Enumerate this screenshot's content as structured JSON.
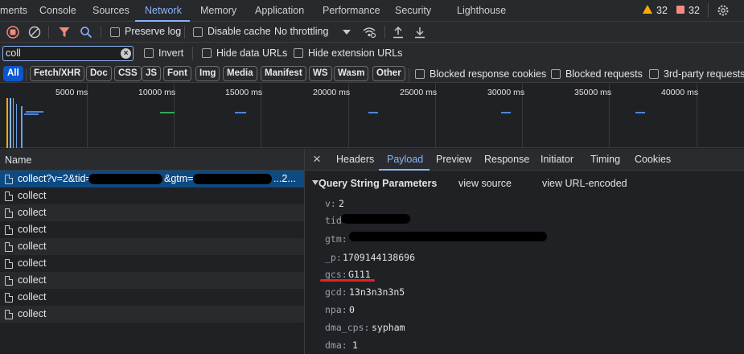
{
  "tabs": [
    "ments",
    "Console",
    "Sources",
    "Network",
    "Memory",
    "Application",
    "Performance",
    "Security",
    "Lighthouse"
  ],
  "warnings": {
    "count": "32",
    "issues": "32"
  },
  "toolbar": {
    "preserve_log": "Preserve log",
    "disable_cache": "Disable cache",
    "throttling": "No throttling"
  },
  "filter": {
    "value": "coll",
    "invert": "Invert",
    "hide_data": "Hide data URLs",
    "hide_ext": "Hide extension URLs"
  },
  "type_chips": [
    "All",
    "Fetch/XHR",
    "Doc",
    "CSS",
    "JS",
    "Font",
    "Img",
    "Media",
    "Manifest",
    "WS",
    "Wasm",
    "Other"
  ],
  "filter_opts": {
    "blocked_cookies": "Blocked response cookies",
    "blocked_requests": "Blocked requests",
    "third_party": "3rd-party requests"
  },
  "timeline_labels": [
    "5000 ms",
    "10000 ms",
    "15000 ms",
    "20000 ms",
    "25000 ms",
    "30000 ms",
    "35000 ms",
    "40000 ms"
  ],
  "requests": {
    "header": "Name",
    "first": {
      "a": "collect?v=2&tid=",
      "b": "&gtm=",
      "c": "...2..."
    },
    "rows": [
      "collect",
      "collect",
      "collect",
      "collect",
      "collect",
      "collect",
      "collect",
      "collect"
    ]
  },
  "detail": {
    "tabs": [
      "Headers",
      "Payload",
      "Preview",
      "Response",
      "Initiator",
      "Timing",
      "Cookies"
    ],
    "section": "Query String Parameters",
    "view_source": "view source",
    "view_url": "view URL-encoded",
    "params": [
      {
        "key": "v:",
        "value": "2"
      },
      {
        "key": "tid:",
        "value": ""
      },
      {
        "key": "gtm:",
        "value": ""
      },
      {
        "key": "_p:",
        "value": "1709144138696"
      },
      {
        "key": "gcs:",
        "value": "G111"
      },
      {
        "key": "gcd:",
        "value": "13n3n3n3n5"
      },
      {
        "key": "npa:",
        "value": "0"
      },
      {
        "key": "dma_cps:",
        "value": "sypham"
      },
      {
        "key": "dma:",
        "value": "1"
      }
    ]
  },
  "colors": {
    "accent": "#8ab4f8",
    "record": "#f28b82",
    "filter_active": "#f28b82",
    "underline": "#e02424"
  }
}
